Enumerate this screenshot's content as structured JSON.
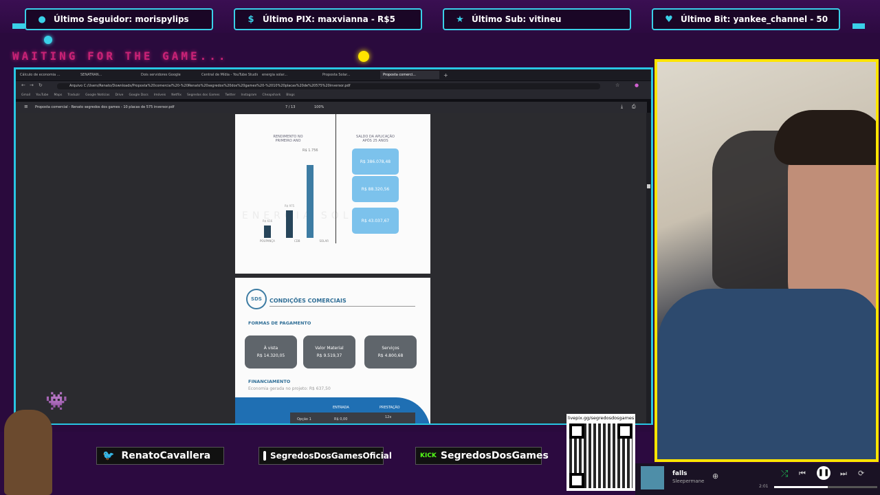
{
  "top_alerts": [
    {
      "icon": "user-icon",
      "label": "Último Seguidor: morispylips"
    },
    {
      "icon": "dollar-icon",
      "label": "Último PIX: maxvianna - R$5"
    },
    {
      "icon": "star-icon",
      "label": "Último Sub: vitineu"
    },
    {
      "icon": "diamond-icon",
      "label": "Último Bit: yankee_channel - 50"
    }
  ],
  "waiting_text": "WAITING FOR THE GAME...",
  "browser": {
    "tabs": [
      "Cálculo de economia ...",
      "SENATRAN...",
      "Dois servidores Google",
      "Central de Mídia - YouTube Studio",
      "energia solar...",
      "Proposta Solar...",
      "Proposta comerci..."
    ],
    "url": "C:/Users/Renato/Downloads/Proposta%20comercial%20-%20Renato%20segredos%20dos%20games%20-%2010%20placas%20de%20575%20inversor.pdf",
    "address_prefix": "Arquivo",
    "bookmarks": [
      "Gmail",
      "YouTube",
      "Maps",
      "Traduzir",
      "Google Notícias",
      "Drive",
      "Google Docs",
      "Imóveis",
      "Netflix",
      "Segredos dos Games",
      "Twitter",
      "Instagram",
      "Cheapshark",
      "Blogs"
    ],
    "pdf_title": "Proposta comercial - Renato segredos dos games - 10 placas de 575 inversor.pdf",
    "page_indicator": "7 / 13",
    "zoom": "100%"
  },
  "pdf_page1": {
    "left_header": "RENDIMENTO NO PRIMEIRO ANO",
    "right_header": "SALDO DA APLICAÇÃO APÓS 25 ANOS",
    "bar_top_label": "R$ 1.756",
    "bar_labels": [
      "POUPANÇA",
      "CDB",
      "SOLAR"
    ],
    "bar_values": [
      "R$ 616",
      "R$ 975",
      "R$ 1.756"
    ],
    "right_values": [
      "R$ 386.078,48",
      "R$ 88.320,56",
      "R$ 43.037,67"
    ],
    "watermark": "ENERGIA SOLAR"
  },
  "pdf_page2": {
    "logo": "SDS",
    "title": "CONDIÇÕES COMERCIAIS",
    "payment_header": "FORMAS DE PAGAMENTO",
    "payments": [
      {
        "label": "À vista",
        "value": "R$ 14.320,05"
      },
      {
        "label": "Valor Material",
        "value": "R$ 9.519,37"
      },
      {
        "label": "Serviços",
        "value": "R$ 4.800,68"
      }
    ],
    "financing_header": "FINANCIAMENTO",
    "financing_text": "Economia gerada no projeto: R$ 637,50",
    "table_headers": [
      "ENTRADA",
      "PRESTAÇÃO"
    ],
    "table_row": {
      "option": "Opção 1",
      "entrada": "R$ 0,00",
      "prestacao": "12x"
    }
  },
  "socials": [
    {
      "icon": "twitter-icon",
      "handle": "RenatoCavallera"
    },
    {
      "icon": "instagram-icon",
      "handle": "SegredosDosGamesOficial"
    },
    {
      "icon": "kick-icon",
      "badge": "KICK",
      "handle": "SegredosDosGames"
    }
  ],
  "qr_url": "livepix.gg/segredosdosgames",
  "player": {
    "track": "falls",
    "artist": "Sleepermane",
    "time": "2:01"
  },
  "colors": {
    "accent_cyan": "#28c6e3",
    "accent_yellow": "#ffe400",
    "bg_purple": "#2c0a40",
    "pdf_blue": "#7cc2ec"
  }
}
